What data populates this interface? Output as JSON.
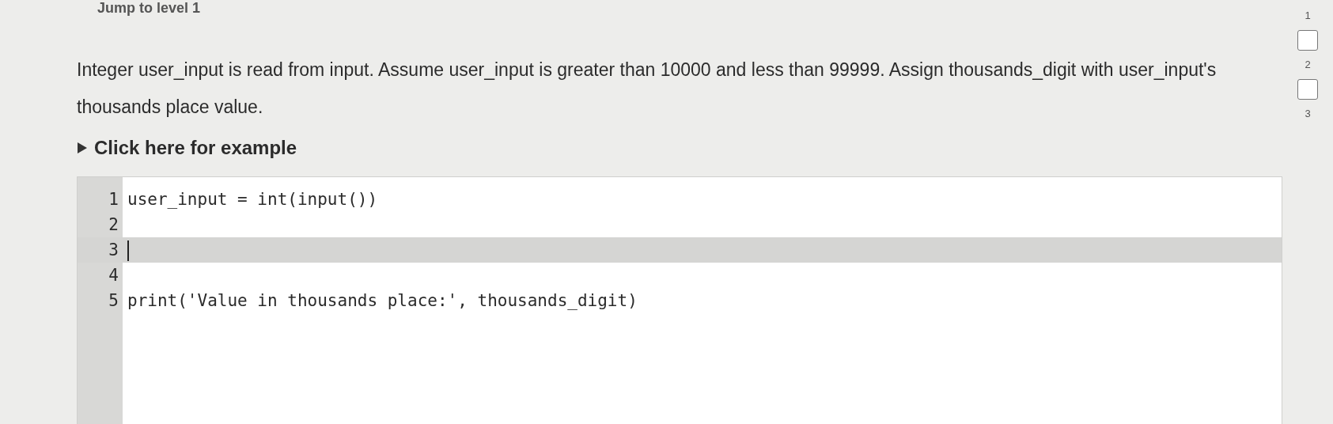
{
  "jump_link": "Jump to level 1",
  "prompt": "Integer user_input is read from input. Assume user_input is greater than 10000 and less than 99999. Assign thousands_digit with user_input's thousands place value.",
  "example_toggle": {
    "label": "Click here for example",
    "expanded": false
  },
  "editor": {
    "lines": [
      {
        "number": "1",
        "code": "user_input = int(input())",
        "active": false
      },
      {
        "number": "2",
        "active": false
      },
      {
        "number": "3",
        "active": true
      },
      {
        "number": "4",
        "active": false
      },
      {
        "number": "5",
        "code": "print('Value in thousands place:', thousands_digit)",
        "active": false
      }
    ]
  },
  "levels": [
    {
      "number": "1",
      "completed": false
    },
    {
      "number": "2",
      "completed": false
    },
    {
      "number": "3"
    }
  ]
}
